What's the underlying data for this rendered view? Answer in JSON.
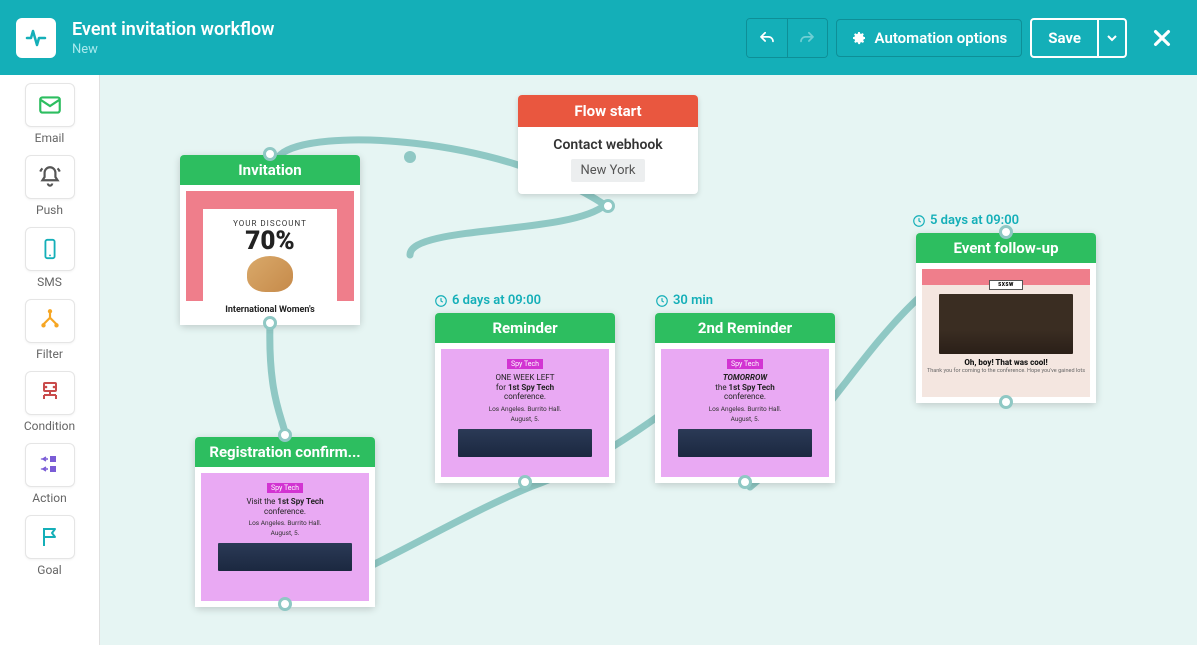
{
  "header": {
    "title": "Event invitation workflow",
    "status": "New",
    "automation_options": "Automation options",
    "save": "Save"
  },
  "sidebar": {
    "items": [
      {
        "label": "Email",
        "color": "#2dbe60",
        "icon": "mail"
      },
      {
        "label": "Push",
        "color": "#555555",
        "icon": "bell"
      },
      {
        "label": "SMS",
        "color": "#14afb8",
        "icon": "phone"
      },
      {
        "label": "Filter",
        "color": "#f6a623",
        "icon": "filter"
      },
      {
        "label": "Condition",
        "color": "#c94b4b",
        "icon": "condition"
      },
      {
        "label": "Action",
        "color": "#7a5cd6",
        "icon": "action"
      },
      {
        "label": "Goal",
        "color": "#14afb8",
        "icon": "flag"
      }
    ]
  },
  "flow_start": {
    "title": "Flow start",
    "subtitle": "Contact webhook",
    "tag": "New York"
  },
  "nodes": {
    "invitation": {
      "title": "Invitation",
      "preview_line1": "YOUR DISCOUNT",
      "preview_line2": "70%",
      "preview_footer": "International Women's"
    },
    "registration": {
      "title": "Registration confirm...",
      "tag": "Spy Tech",
      "line1_html": "Visit the <b>1st Spy Tech</b>",
      "line2": "conference.",
      "loc": "Los Angeles. Burrito Hall.",
      "date": "August, 5."
    },
    "reminder": {
      "title": "Reminder",
      "timing": "6 days at 09:00",
      "tag": "Spy Tech",
      "line1": "ONE WEEK LEFT",
      "line2_html": "for <b>1st Spy Tech</b>",
      "line3": "conference.",
      "loc": "Los Angeles. Burrito Hall.",
      "date": "August, 5."
    },
    "reminder2": {
      "title": "2nd Reminder",
      "timing": "30 min",
      "tag": "Spy Tech",
      "line1_html": "<b><i>TOMORROW</i></b>",
      "line2_html": "the <b>1st Spy Tech</b>",
      "line3": "conference.",
      "loc": "Los Angeles. Burrito Hall.",
      "date": "August, 5."
    },
    "followup": {
      "title": "Event follow-up",
      "timing": "5 days at 09:00",
      "brand": "SXSW",
      "caption": "Oh, boy! That was cool!",
      "sub": "Thank you for coming to the conference. Hope you've gained lots"
    }
  }
}
